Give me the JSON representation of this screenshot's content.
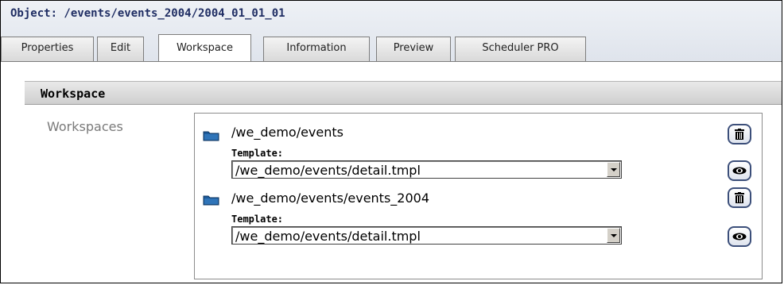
{
  "header": {
    "object_title": "Object: /events/events_2004/2004_01_01_01"
  },
  "tabs": [
    {
      "label": "Properties"
    },
    {
      "label": "Edit"
    },
    {
      "label": "Workspace",
      "active": true
    },
    {
      "label": "Information"
    },
    {
      "label": "Preview"
    },
    {
      "label": "Scheduler PRO"
    }
  ],
  "section": {
    "title": "Workspace",
    "row_label": "Workspaces"
  },
  "workspaces": [
    {
      "path": "/we_demo/events",
      "template_label": "Template:",
      "template_value": "/we_demo/events/detail.tmpl",
      "icon": "folder-icon"
    },
    {
      "path": "/we_demo/events/events_2004",
      "template_label": "Template:",
      "template_value": "/we_demo/events/detail.tmpl",
      "icon": "folder-icon"
    }
  ],
  "colors": {
    "title_blue": "#1f2d63",
    "folder_blue": "#1d5a9a",
    "button_border": "#3c4f7a"
  }
}
